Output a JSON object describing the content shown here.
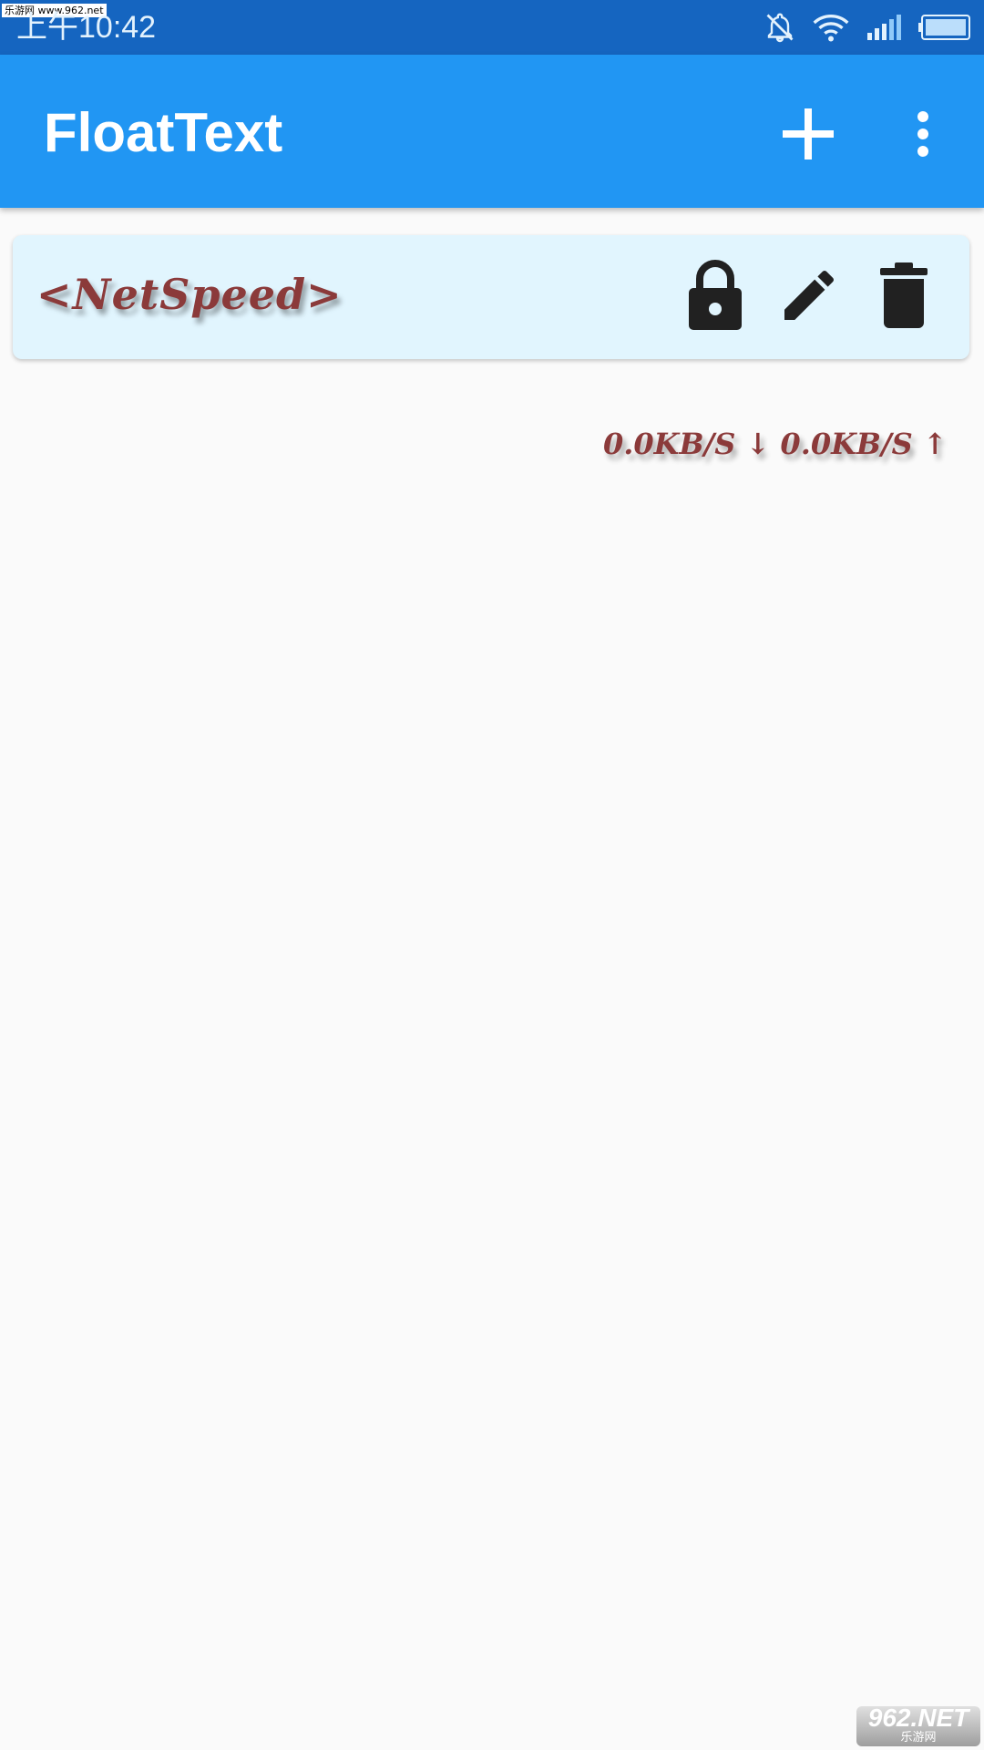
{
  "status_bar": {
    "time": "上午10:42",
    "watermark": "乐游网 www.962.net",
    "icons": [
      "bell-off-icon",
      "wifi-icon",
      "signal-icon",
      "battery-icon"
    ]
  },
  "app_bar": {
    "title": "FloatText",
    "actions": [
      "add-icon",
      "more-vert-icon"
    ]
  },
  "list": {
    "items": [
      {
        "text": "<NetSpeed>",
        "actions": [
          "lock-icon",
          "edit-icon",
          "delete-icon"
        ]
      }
    ]
  },
  "floating_text": {
    "value": "0.0KB/S ↓ 0.0KB/S ↑"
  },
  "watermark_bottom": {
    "main": "962.NET",
    "sub": "乐游网"
  },
  "colors": {
    "status_bar": "#1565c0",
    "app_bar": "#2196f3",
    "card_bg": "#e1f5fe",
    "float_text": "#8b3a3a",
    "page_bg": "#fafafa"
  }
}
